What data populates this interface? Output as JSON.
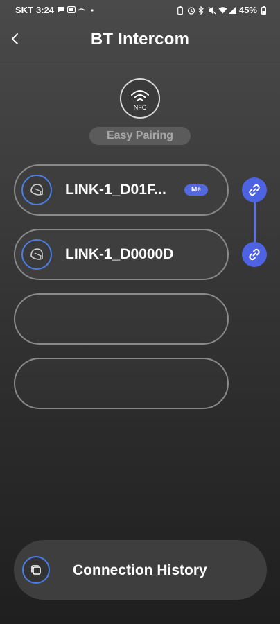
{
  "status_bar": {
    "carrier": "SKT",
    "time": "3:24",
    "battery": "45%",
    "icons_left": [
      "chat-icon",
      "box-icon",
      "dash-icon",
      "dot-icon"
    ],
    "icons_right": [
      "battery-saver-icon",
      "alarm-icon",
      "bluetooth-icon",
      "mute-icon",
      "wifi-icon",
      "signal-icon"
    ]
  },
  "header": {
    "title": "BT Intercom",
    "back_icon": "chevron-left-icon"
  },
  "nfc": {
    "label": "NFC",
    "icon": "nfc-waves-icon"
  },
  "easy_pairing": {
    "label": "Easy Pairing"
  },
  "slots": [
    {
      "name": "LINK-1_D01F...",
      "badge": "Me",
      "filled": true,
      "icon": "helmet-icon"
    },
    {
      "name": "LINK-1_D0000D",
      "badge": "",
      "filled": true,
      "icon": "helmet-icon"
    },
    {
      "name": "",
      "badge": "",
      "filled": false
    },
    {
      "name": "",
      "badge": "",
      "filled": false
    }
  ],
  "links": {
    "icon": "link-icon",
    "accent": "#4d63e2"
  },
  "connection_history": {
    "label": "Connection History",
    "icon": "history-copy-icon"
  },
  "colors": {
    "accent_blue": "#4a7ee6",
    "me_badge": "#5468e0"
  }
}
